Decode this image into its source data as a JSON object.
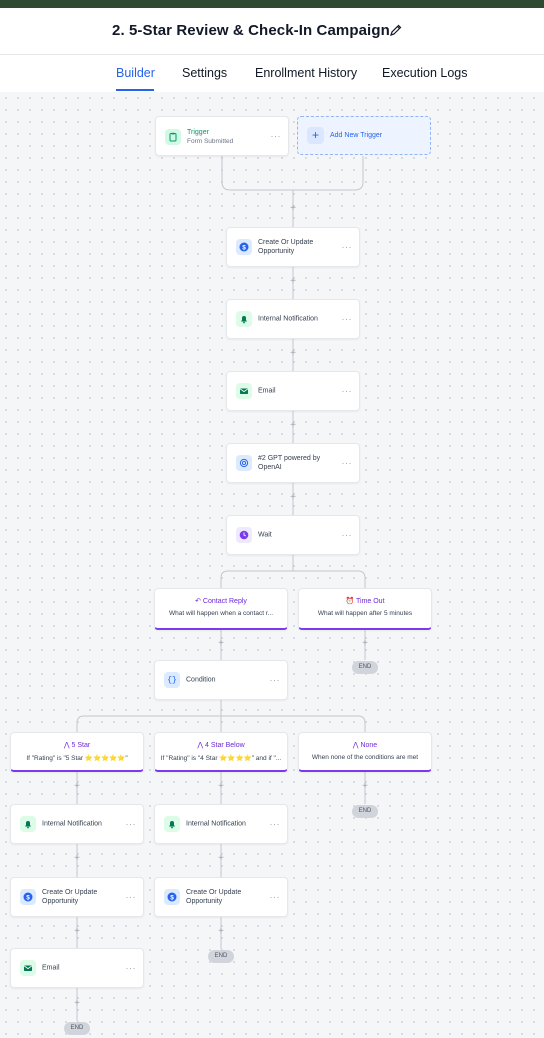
{
  "header": {
    "title": "2. 5-Star Review & Check-In Campaign"
  },
  "tabs": [
    {
      "label": "Builder",
      "active": true
    },
    {
      "label": "Settings"
    },
    {
      "label": "Enrollment History"
    },
    {
      "label": "Execution Logs"
    }
  ],
  "workflow": {
    "trigger": {
      "title": "Trigger",
      "subtitle": "Form Submitted"
    },
    "add_trigger": "Add New Trigger",
    "actions": {
      "opportunity": "Create Or Update Opportunity",
      "notification": "Internal Notification",
      "email": "Email",
      "gpt": "#2 GPT powered by OpenAI",
      "wait": "Wait",
      "condition": "Condition"
    },
    "wait_branches": {
      "contact_reply": {
        "title": "Contact Reply",
        "subtitle": "What will happen when a contact r..."
      },
      "time_out": {
        "title": "Time Out",
        "subtitle": "What will happen after 5 minutes"
      }
    },
    "condition_branches": {
      "five_star": {
        "title": "5 Star",
        "subtitle": "If \"Rating\" is \"5 Star ⭐⭐⭐⭐⭐\""
      },
      "four_star": {
        "title": "4 Star Below",
        "subtitle": "If \"Rating\" is \"4 Star ⭐⭐⭐⭐\" and if \"..."
      },
      "none": {
        "title": "None",
        "subtitle": "When none of the conditions are met"
      }
    },
    "end_label": "END",
    "more_label": "···",
    "plus_label": "+"
  },
  "colors": {
    "accent": "#2563eb",
    "branch": "#7c3aed",
    "trigger": "#059669"
  }
}
